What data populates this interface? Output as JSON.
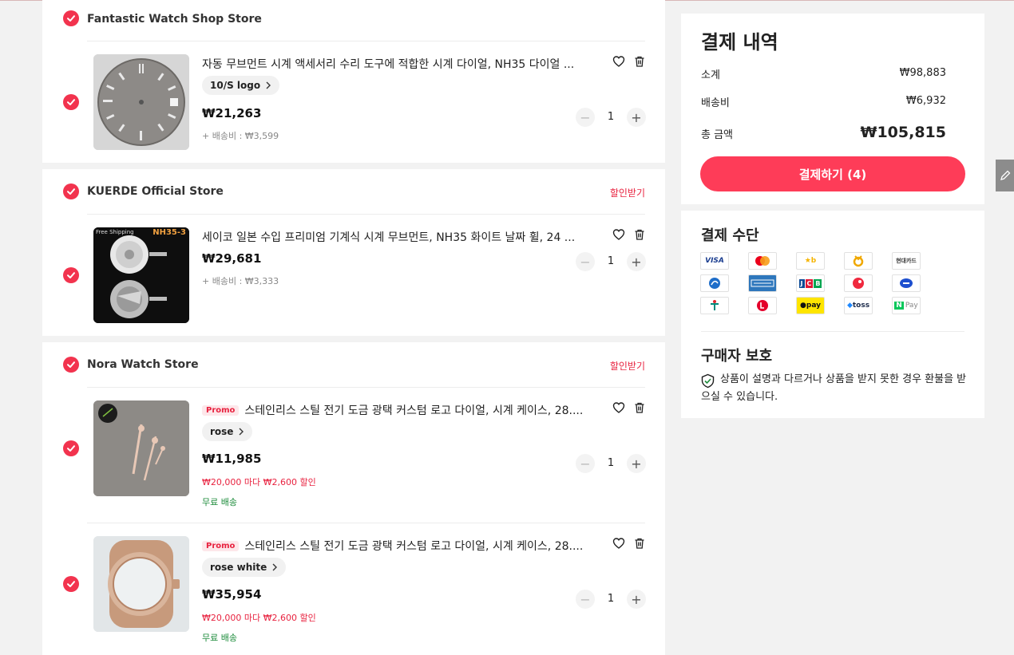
{
  "stores": [
    {
      "name": "Fantastic Watch Shop Store",
      "coupon": "",
      "items": [
        {
          "title": "자동 무브먼트 시계 액세서리 수리 도구에 적합한 시계 다이얼, NH35 다이얼 ...",
          "promo": "",
          "variant": "10/S logo",
          "price": "₩21,263",
          "shipping": "+ 배송비 : ₩3,599",
          "discount": "",
          "free_shipping": "",
          "quantity": "1"
        }
      ]
    },
    {
      "name": "KUERDE Official Store",
      "coupon": "할인받기",
      "items": [
        {
          "title": "세이코 일본 수입 프리미엄 기계식 시계 무브먼트, NH35 화이트 날짜 휠, 24 ...",
          "promo": "",
          "variant": "",
          "price": "₩29,681",
          "shipping": "+ 배송비 : ₩3,333",
          "discount": "",
          "free_shipping": "",
          "quantity": "1",
          "image_tags": [
            "Free Shipping",
            "NH35-3"
          ]
        }
      ]
    },
    {
      "name": "Nora Watch Store",
      "coupon": "할인받기",
      "items": [
        {
          "title": "스테인리스 스틸 전기 도금 광택 커스텀 로고 다이얼, 시계 케이스, 28....",
          "promo": "Promo",
          "variant": "rose",
          "price": "₩11,985",
          "shipping": "",
          "discount": "₩20,000 마다 ₩2,600 할인",
          "free_shipping": "무료 배송",
          "quantity": "1"
        },
        {
          "title": "스테인리스 스틸 전기 도금 광택 커스텀 로고 다이얼, 시계 케이스, 28....",
          "promo": "Promo",
          "variant": "rose white",
          "price": "₩35,954",
          "shipping": "",
          "discount": "₩20,000 마다 ₩2,600 할인",
          "free_shipping": "무료 배송",
          "quantity": "1"
        }
      ]
    }
  ],
  "summary": {
    "title": "결제 내역",
    "subtotal_label": "소계",
    "subtotal": "₩98,883",
    "shipping_label": "배송비",
    "shipping": "₩6,932",
    "total_label": "총 금액",
    "total": "₩105,815",
    "checkout_label": "결제하기 (4)"
  },
  "payment": {
    "title": "결제 수단",
    "methods": [
      {
        "label": "VISA",
        "icon": "visa-icon"
      },
      {
        "label": "",
        "icon": "mastercard-icon"
      },
      {
        "label": "",
        "icon": "kb-card-icon"
      },
      {
        "label": "",
        "icon": "nh-card-icon"
      },
      {
        "label": "현대카드",
        "icon": "hyundai-card-icon"
      },
      {
        "label": "",
        "icon": "shinhan-card-icon"
      },
      {
        "label": "",
        "icon": "amex-icon"
      },
      {
        "label": "JCB",
        "icon": "jcb-icon"
      },
      {
        "label": "",
        "icon": "bc-card-icon"
      },
      {
        "label": "",
        "icon": "samsung-card-icon"
      },
      {
        "label": "",
        "icon": "hana-card-icon"
      },
      {
        "label": "",
        "icon": "lotte-card-icon"
      },
      {
        "label": "pay",
        "icon": "kakaopay-icon"
      },
      {
        "label": "toss",
        "icon": "toss-icon"
      },
      {
        "label": "Pay",
        "icon": "naverpay-icon"
      }
    ]
  },
  "protection": {
    "title": "구매자 보호",
    "text": "상품이 설명과 다르거나 상품을 받지 못한 경우 환불을 받으실 수 있습니다."
  },
  "colors": {
    "accent": "#fe3c58",
    "check": "#f2334e",
    "discount": "#e8223f",
    "free_shipping": "#1b8b3a"
  }
}
